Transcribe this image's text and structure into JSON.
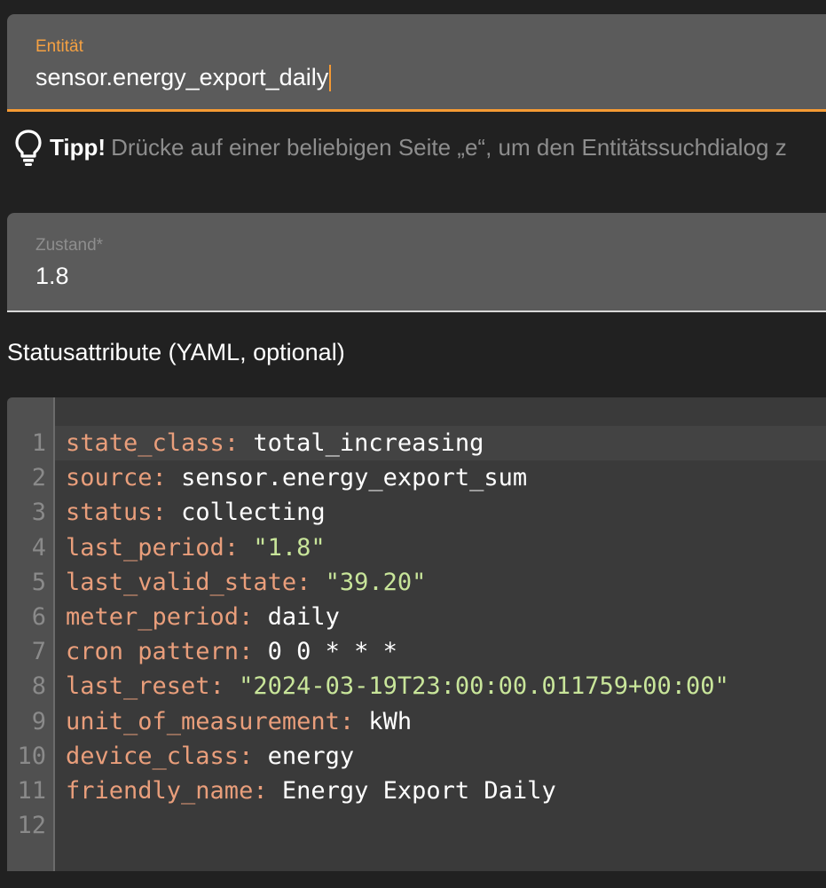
{
  "entity": {
    "label": "Entität",
    "value": "sensor.energy_export_daily"
  },
  "tip": {
    "strong": "Tipp!",
    "text": "Drücke auf einer beliebigen Seite „e“, um den Entitätssuchdialog z",
    "icon": "lightbulb-icon"
  },
  "state": {
    "label": "Zustand*",
    "value": "1.8"
  },
  "attributes": {
    "label": "Statusattribute (YAML, optional)"
  },
  "editor": {
    "lines": [
      {
        "num": "1",
        "key": "state_class",
        "sep": ": ",
        "val": "total_increasing",
        "kind": "v"
      },
      {
        "num": "2",
        "key": "source",
        "sep": ": ",
        "val": "sensor.energy_export_sum",
        "kind": "v"
      },
      {
        "num": "3",
        "key": "status",
        "sep": ": ",
        "val": "collecting",
        "kind": "v"
      },
      {
        "num": "4",
        "key": "last_period",
        "sep": ": ",
        "val": "\"1.8\"",
        "kind": "s"
      },
      {
        "num": "5",
        "key": "last_valid_state",
        "sep": ": ",
        "val": "\"39.20\"",
        "kind": "s"
      },
      {
        "num": "6",
        "key": "meter_period",
        "sep": ": ",
        "val": "daily",
        "kind": "v"
      },
      {
        "num": "7",
        "key": "cron pattern",
        "sep": ": ",
        "val": "0 0 * * *",
        "kind": "v"
      },
      {
        "num": "8",
        "key": "last_reset",
        "sep": ": ",
        "val": "\"2024-03-19T23:00:00.011759+00:00\"",
        "kind": "s"
      },
      {
        "num": "9",
        "key": "unit_of_measurement",
        "sep": ": ",
        "val": "kWh",
        "kind": "v"
      },
      {
        "num": "10",
        "key": "device_class",
        "sep": ": ",
        "val": "energy",
        "kind": "v"
      },
      {
        "num": "11",
        "key": "friendly_name",
        "sep": ": ",
        "val": "Energy Export Daily",
        "kind": "v"
      },
      {
        "num": "12",
        "key": "",
        "sep": "",
        "val": "",
        "kind": "v"
      }
    ]
  },
  "colors": {
    "accent": "#f59a33",
    "yaml_key": "#e99e7b",
    "yaml_string": "#c8e59a",
    "background": "#212121",
    "field_bg": "#5b5b5b"
  }
}
